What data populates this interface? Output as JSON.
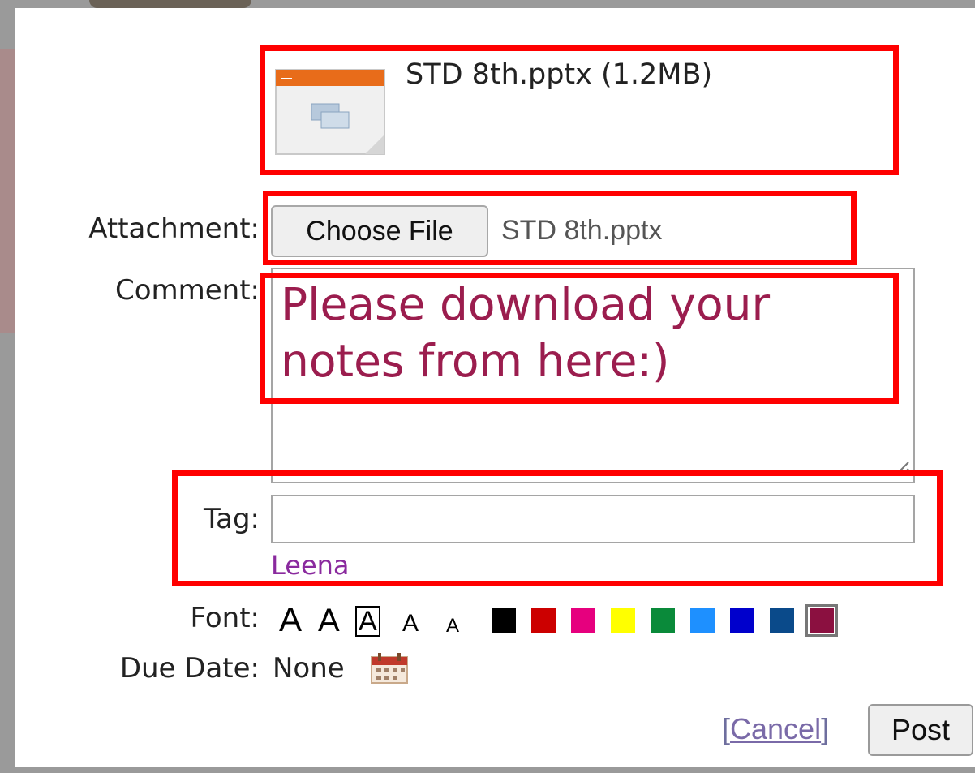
{
  "attachment_preview": {
    "file_label": "STD 8th.pptx (1.2MB)",
    "icon": "pptx-file-icon"
  },
  "attachment": {
    "label": "Attachment:",
    "button_label": "Choose File",
    "chosen_file": "STD 8th.pptx"
  },
  "comment": {
    "label": "Comment:",
    "value": "Please download your notes from here:)",
    "text_color": "#9b1d4e"
  },
  "tag": {
    "label": "Tag:",
    "value": "",
    "suggestion": "Leena"
  },
  "font": {
    "label": "Font:",
    "styles": [
      "A",
      "A",
      "A",
      "A",
      "A"
    ],
    "colors": [
      "#000000",
      "#cc0000",
      "#e6007e",
      "#ffff00",
      "#0a8a3a",
      "#1e90ff",
      "#0000cc",
      "#0a4a8a",
      "#8b1040"
    ],
    "selected_color": "#8b1040"
  },
  "due_date": {
    "label": "Due Date:",
    "value": "None",
    "icon": "calendar-icon"
  },
  "actions": {
    "cancel_open": "[",
    "cancel_label": "Cancel",
    "cancel_close": "]",
    "post_label": "Post"
  },
  "highlight_color": "#ff0000"
}
